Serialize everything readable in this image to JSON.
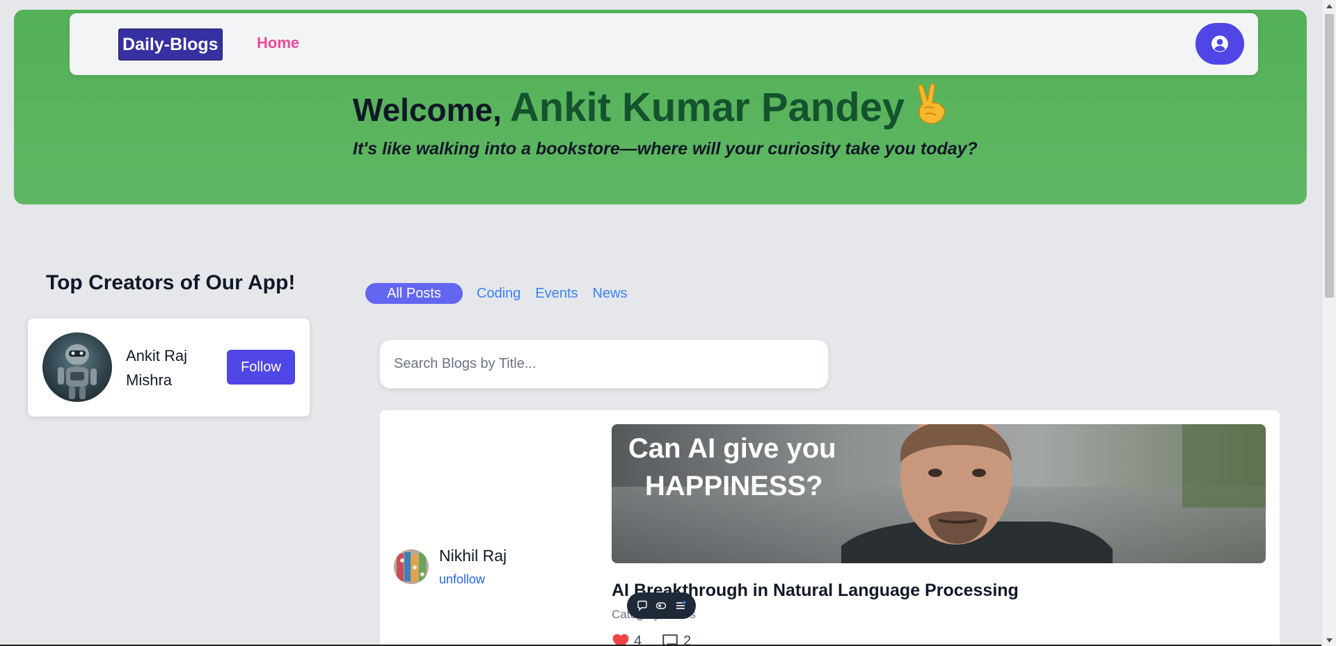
{
  "nav": {
    "brand": "Daily-Blogs",
    "home": "Home",
    "profile_icon": "user-circle-icon"
  },
  "hero": {
    "welcome_prefix": "Welcome,",
    "user_name": "Ankit Kumar Pandey",
    "emoji": "victory-hand-emoji",
    "tagline": "It's like walking into a bookstore—where will your curiosity take you today?"
  },
  "sidebar": {
    "title": "Top Creators of Our App!",
    "creators": [
      {
        "name": "Ankit Raj Mishra",
        "button": "Follow"
      }
    ]
  },
  "tabs": [
    "All Posts",
    "Coding",
    "Events",
    "News"
  ],
  "active_tab": "All Posts",
  "search": {
    "placeholder": "Search Blogs by Title...",
    "value": ""
  },
  "posts": [
    {
      "author": "Nikhil Raj",
      "author_action": "unfollow",
      "image_text_line1": "Can AI give you",
      "image_text_line2": "HAPPINESS?",
      "title": "AI Breakthrough in Natural Language Processing",
      "category": "Category: News",
      "likes": "4",
      "comments": "2"
    }
  ],
  "colors": {
    "hero_green": "#5cb660",
    "brand_bg": "#3730a3",
    "accent_indigo": "#4f46e5",
    "home_pink": "#ec4899",
    "link_blue": "#3b82f6"
  }
}
